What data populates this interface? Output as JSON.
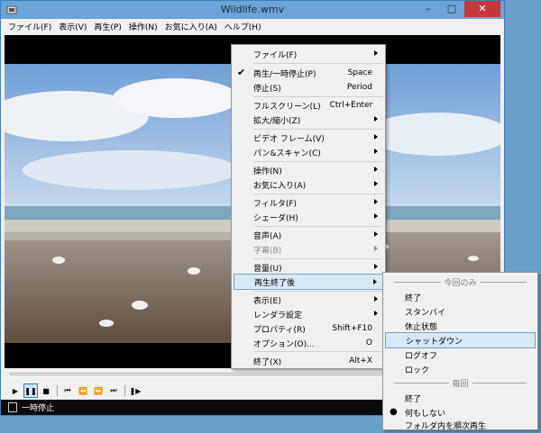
{
  "window": {
    "title": "Wildlife.wmv"
  },
  "menubar": [
    "ファイル(F)",
    "表示(V)",
    "再生(P)",
    "操作(N)",
    "お気に入り(A)",
    "ヘルプ(H)"
  ],
  "status": {
    "text": "一時停止"
  },
  "main_menu": {
    "items": [
      {
        "label": "ファイル(F)",
        "submenu": true
      },
      {
        "label": "再生/一時停止(P)",
        "shortcut": "Space",
        "checked": true
      },
      {
        "label": "停止(S)",
        "shortcut": "Period"
      },
      {
        "label": "フルスクリーン(L)",
        "shortcut": "Ctrl+Enter"
      },
      {
        "label": "拡大/縮小(Z)",
        "submenu": true
      },
      {
        "label": "ビデオ フレーム(V)",
        "submenu": true
      },
      {
        "label": "パン&スキャン(C)",
        "submenu": true
      },
      {
        "label": "操作(N)",
        "submenu": true
      },
      {
        "label": "お気に入り(A)",
        "submenu": true
      },
      {
        "label": "フィルタ(F)",
        "submenu": true
      },
      {
        "label": "シェーダ(H)",
        "submenu": true
      },
      {
        "label": "音声(A)",
        "submenu": true
      },
      {
        "label": "字幕(B)",
        "submenu": true,
        "disabled": true
      },
      {
        "label": "音量(U)",
        "submenu": true
      },
      {
        "label": "再生終了後",
        "submenu": true,
        "highlighted": true
      },
      {
        "label": "表示(E)",
        "submenu": true
      },
      {
        "label": "レンダラ設定",
        "submenu": true
      },
      {
        "label": "プロパティ(R)",
        "shortcut": "Shift+F10"
      },
      {
        "label": "オプション(O)...",
        "shortcut": "O"
      },
      {
        "label": "終了(X)",
        "shortcut": "Alt+X"
      }
    ]
  },
  "sub_menu": {
    "group1_header": "今回のみ",
    "group1": [
      {
        "label": "終了"
      },
      {
        "label": "スタンバイ"
      },
      {
        "label": "休止状態"
      },
      {
        "label": "シャットダウン",
        "highlighted": true
      },
      {
        "label": "ログオフ"
      },
      {
        "label": "ロック"
      }
    ],
    "group2_header": "毎回",
    "group2": [
      {
        "label": "終了"
      },
      {
        "label": "何もしない",
        "selected": true
      },
      {
        "label": "フォルダ内を順次再生"
      }
    ]
  }
}
